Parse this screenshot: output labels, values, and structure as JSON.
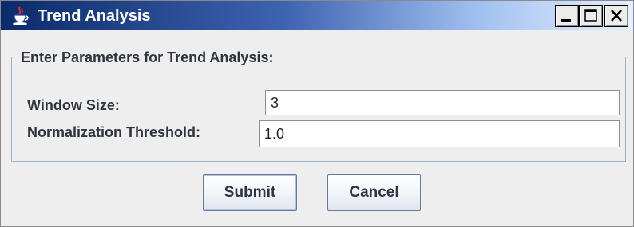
{
  "window": {
    "title": "Trend Analysis",
    "icon": "java-cup-icon",
    "controls": [
      "minimize-icon",
      "maximize-icon",
      "close-icon"
    ]
  },
  "form": {
    "group_title": "Enter Parameters for Trend Analysis:",
    "fields": [
      {
        "label": "Window Size:",
        "value": "3"
      },
      {
        "label": "Normalization Threshold:",
        "value": "1.0"
      }
    ]
  },
  "buttons": {
    "submit_label": "Submit",
    "cancel_label": "Cancel"
  },
  "colors": {
    "titlebar_start": "#0a2a6a",
    "titlebar_end": "#e6f0ff",
    "window_bg": "#eeeeee",
    "group_border": "#9fb3d0"
  }
}
